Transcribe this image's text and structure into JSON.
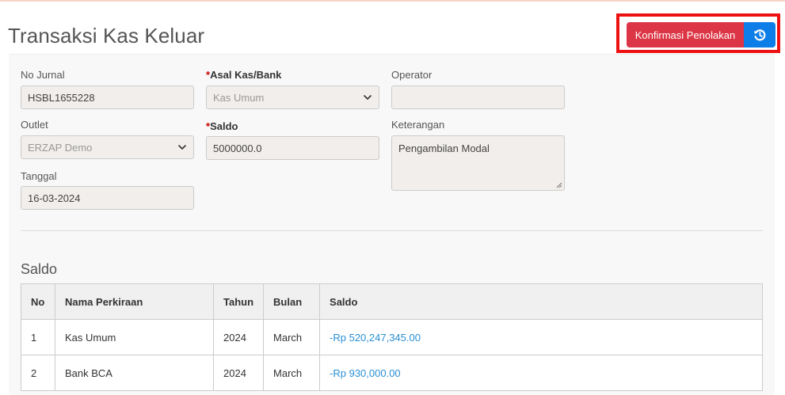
{
  "page": {
    "title": "Transaksi Kas Keluar"
  },
  "actions": {
    "confirm_label": "Konfirmasi Penolakan",
    "reset_icon": "history-icon"
  },
  "form": {
    "no_jurnal": {
      "label": "No Jurnal",
      "value": "HSBL1655228"
    },
    "asal_kas": {
      "label": "Asal Kas/Bank",
      "required_mark": "*",
      "value": "Kas Umum"
    },
    "operator": {
      "label": "Operator",
      "value": ""
    },
    "outlet": {
      "label": "Outlet",
      "value": "ERZAP Demo"
    },
    "saldo": {
      "label": "Saldo",
      "required_mark": "*",
      "value": "5000000.0"
    },
    "keterangan": {
      "label": "Keterangan",
      "value": "Pengambilan Modal"
    },
    "tanggal": {
      "label": "Tanggal",
      "value": "16-03-2024"
    }
  },
  "saldo_section": {
    "title": "Saldo",
    "columns": [
      "No",
      "Nama Perkiraan",
      "Tahun",
      "Bulan",
      "Saldo"
    ],
    "rows": [
      {
        "no": "1",
        "nama": "Kas Umum",
        "tahun": "2024",
        "bulan": "March",
        "saldo": "-Rp 520,247,345.00"
      },
      {
        "no": "2",
        "nama": "Bank BCA",
        "tahun": "2024",
        "bulan": "March",
        "saldo": "-Rp 930,000.00"
      }
    ]
  },
  "colors": {
    "danger": "#dc3545",
    "primary": "#0d7ee8",
    "link": "#2a8fd4",
    "highlight": "#ee1111"
  }
}
